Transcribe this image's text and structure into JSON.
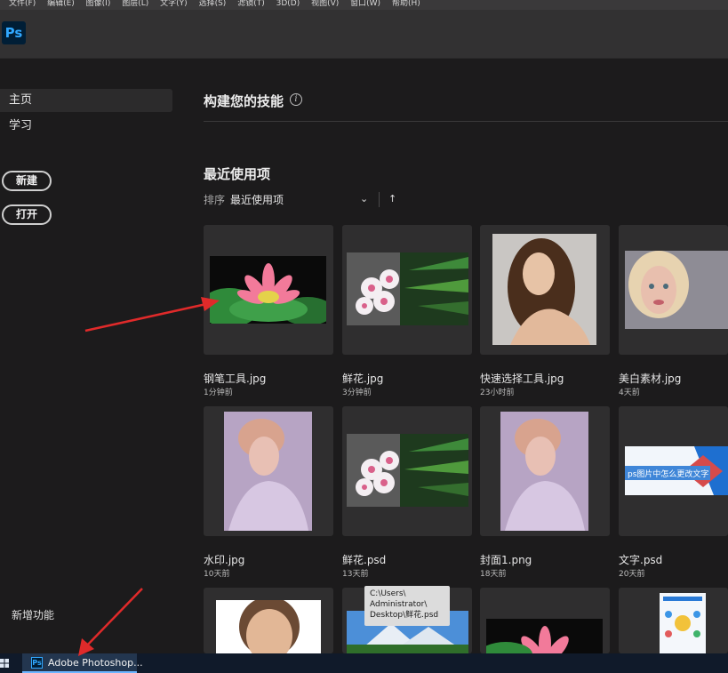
{
  "menu": [
    "文件(F)",
    "编辑(E)",
    "图像(I)",
    "图层(L)",
    "文字(Y)",
    "选择(S)",
    "滤镜(T)",
    "3D(D)",
    "视图(V)",
    "窗口(W)",
    "帮助(H)"
  ],
  "app": {
    "logo": "Ps"
  },
  "sidebar": {
    "items": [
      {
        "label": "主页"
      },
      {
        "label": "学习"
      }
    ],
    "new_button": "新建",
    "open_button": "打开",
    "new_features": "新增功能"
  },
  "main": {
    "skills_title": "构建您的技能",
    "info_icon": "i",
    "recent_title": "最近使用项",
    "sort_label": "排序",
    "sort_value": "最近使用项"
  },
  "recent_files": [
    {
      "name": "钢笔工具.jpg",
      "time": "1分钟前"
    },
    {
      "name": "鲜花.jpg",
      "time": "3分钟前"
    },
    {
      "name": "快速选择工具.jpg",
      "time": "23小时前"
    },
    {
      "name": "美白素材.jpg",
      "time": "4天前"
    },
    {
      "name": "水印.jpg",
      "time": "10天前"
    },
    {
      "name": "鲜花.psd",
      "time": "13天前"
    },
    {
      "name": "封面1.png",
      "time": "18天前"
    },
    {
      "name": "文字.psd",
      "time": "20天前"
    }
  ],
  "thumb_text": {
    "banner": "ps图片中怎么更改文字"
  },
  "tooltip": {
    "line1": "C:\\Users\\",
    "line2": "Administrator\\",
    "line3": "Desktop\\鲜花.psd"
  },
  "taskbar": {
    "ps_icon": "Ps",
    "app_label": "Adobe Photoshop..."
  },
  "colors": {
    "ps_blue": "#31a8ff",
    "ps_dark": "#001e36",
    "annotation_red": "#e02a2a"
  }
}
